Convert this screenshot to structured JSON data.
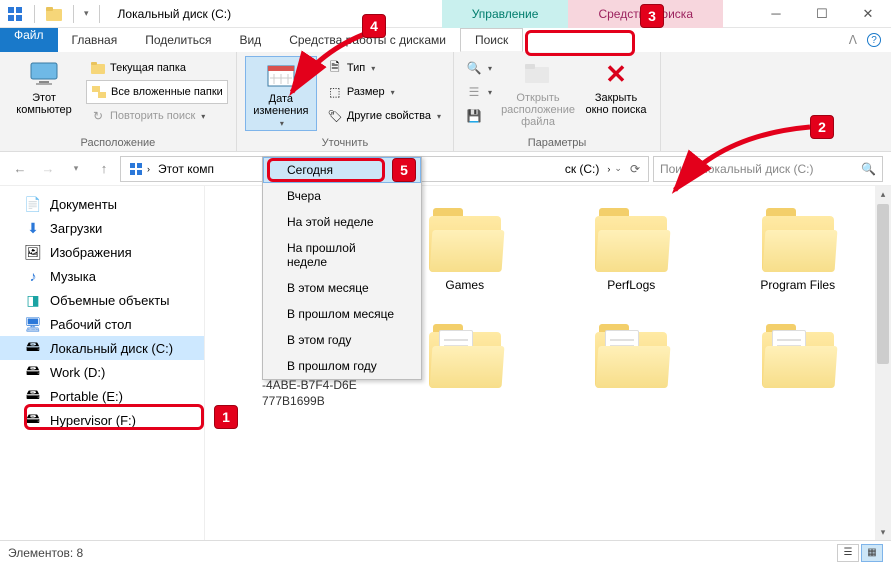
{
  "titlebar": {
    "title": "Локальный диск (C:)",
    "ctx_manage": "Управление",
    "ctx_search": "Средства поиска"
  },
  "tabs": {
    "file": "Файл",
    "home": "Главная",
    "share": "Поделиться",
    "view": "Вид",
    "drive_tools": "Средства работы с дисками",
    "search": "Поиск"
  },
  "ribbon": {
    "group_location": "Расположение",
    "this_pc": "Этот\nкомпьютер",
    "current_folder": "Текущая папка",
    "all_subfolders": "Все вложенные папки",
    "search_again": "Повторить поиск",
    "date_modified": "Дата\nизменения",
    "type": "Тип",
    "size": "Размер",
    "other_props": "Другие свойства",
    "recent": "Последние поисковые запросы",
    "advanced": "Дополнительные параметры",
    "save": "Сохранить условия поиска",
    "open_location": "Открыть\nрасположение файла",
    "close_search": "Закрыть\nокно поиска",
    "group_refine": "Уточнить",
    "group_options": "Параметры"
  },
  "dropdown": {
    "today": "Сегодня",
    "yesterday": "Вчера",
    "this_week": "На этой неделе",
    "last_week": "На прошлой неделе",
    "this_month": "В этом месяце",
    "last_month": "В прошлом месяце",
    "this_year": "В этом году",
    "last_year": "В прошлом году"
  },
  "address": {
    "this_pc": "Этот комп",
    "drive": "ск (C:)"
  },
  "search": {
    "placeholder": "Поиск: Локальный диск (C:)"
  },
  "tree": {
    "documents": "Документы",
    "downloads": "Загрузки",
    "pictures": "Изображения",
    "music": "Музыка",
    "objects3d": "Объемные объекты",
    "desktop": "Рабочий стол",
    "drive_c": "Локальный диск (C:)",
    "drive_d": "Work (D:)",
    "drive_e": "Portable (E:)",
    "drive_f": "Hypervisor (F:)"
  },
  "guid": {
    "line1": "-4ABE-B7F4-D6E",
    "line2": "777B1699B"
  },
  "files": {
    "games": "Games",
    "perflogs": "PerfLogs",
    "program_files": "Program Files"
  },
  "status": {
    "items": "Элементов: 8"
  },
  "annotations": {
    "n1": "1",
    "n2": "2",
    "n3": "3",
    "n4": "4",
    "n5": "5"
  }
}
